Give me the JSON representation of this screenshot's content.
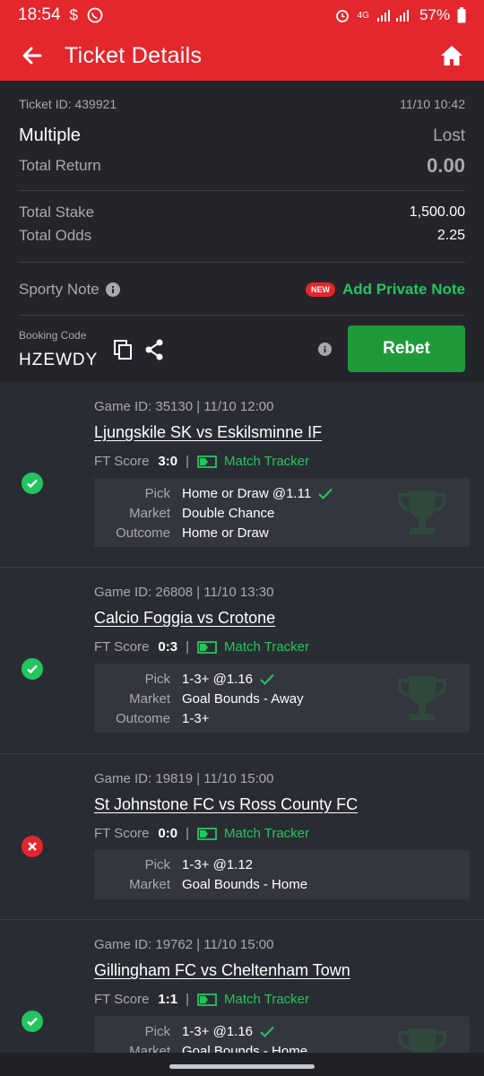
{
  "status_bar": {
    "time": "18:54",
    "battery": "57%",
    "network": "4G",
    "icons": [
      "dollar-icon",
      "whatsapp-icon",
      "alarm-icon",
      "signal-icon",
      "battery-icon"
    ]
  },
  "app_bar": {
    "title": "Ticket Details",
    "back_icon": "arrow-left-icon",
    "home_icon": "home-icon"
  },
  "ticket": {
    "id_label": "Ticket ID: 439921",
    "datetime": "11/10 10:42",
    "type": "Multiple",
    "result": "Lost",
    "total_return_label": "Total Return",
    "total_return": "0.00",
    "total_stake_label": "Total Stake",
    "total_stake": "1,500.00",
    "total_odds_label": "Total Odds",
    "total_odds": "2.25",
    "note_label": "Sporty Note",
    "new_badge": "NEW",
    "add_note": "Add Private Note",
    "booking_label": "Booking Code",
    "booking_code": "HZEWDY",
    "rebet": "Rebet"
  },
  "labels": {
    "ft_score": "FT Score",
    "sep": "|",
    "tracker": "Match Tracker",
    "pick": "Pick",
    "market": "Market",
    "outcome": "Outcome"
  },
  "games": [
    {
      "status": "won",
      "game_id": "Game ID: 35130 | 11/10 12:00",
      "teams": "Ljungskile SK vs Eskilsminne IF",
      "score": "3:0",
      "pick": "Home or Draw @1.11",
      "pick_correct": true,
      "market": "Double Chance",
      "outcome": "Home or Draw"
    },
    {
      "status": "won",
      "game_id": "Game ID: 26808 | 11/10 13:30",
      "teams": "Calcio Foggia vs Crotone",
      "score": "0:3",
      "pick": "1-3+ @1.16",
      "pick_correct": true,
      "market": "Goal Bounds - Away",
      "outcome": "1-3+"
    },
    {
      "status": "lost",
      "game_id": "Game ID: 19819 | 11/10 15:00",
      "teams": "St Johnstone FC vs Ross County FC",
      "score": "0:0",
      "pick": "1-3+ @1.12",
      "pick_correct": false,
      "market": "Goal Bounds - Home",
      "outcome": ""
    },
    {
      "status": "won",
      "game_id": "Game ID: 19762 | 11/10 15:00",
      "teams": "Gillingham FC vs Cheltenham Town",
      "score": "1:1",
      "pick": "1-3+ @1.16",
      "pick_correct": true,
      "market": "Goal Bounds - Home",
      "outcome": ""
    }
  ],
  "colors": {
    "brand_red": "#e4262d",
    "win_green": "#22c55e",
    "rebet_green": "#1e9a3a",
    "bg": "#2a2c33"
  }
}
